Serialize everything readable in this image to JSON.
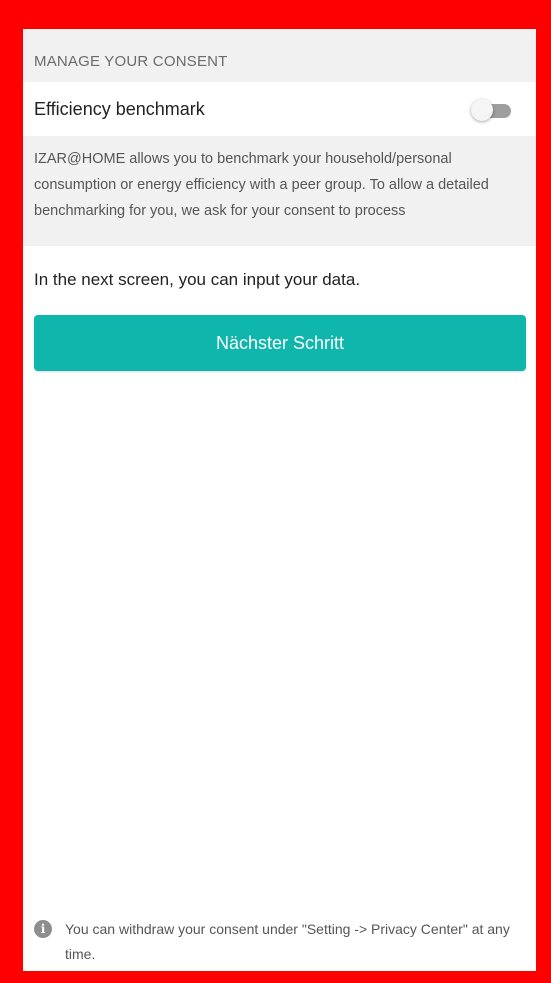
{
  "consent": {
    "section_title": "MANAGE YOUR CONSENT",
    "toggle_label": "Efficiency benchmark",
    "toggle_state": "off",
    "description": "IZAR@HOME allows you to benchmark your household/personal consumption or energy efficiency with a peer group. To allow a detailed benchmarking for you, we ask for your consent to process"
  },
  "main": {
    "next_screen_text": "In the next screen, you can input your data.",
    "next_button_label": "Nächster Schritt"
  },
  "footer": {
    "info_icon": "info-icon",
    "note": "You can withdraw your consent under \"Setting -> Privacy Center\" at any time."
  },
  "colors": {
    "frame_border": "#ff0000",
    "accent": "#0fb6ab",
    "section_bg": "#f1f1f1",
    "switch_track_off": "#9e9e9e"
  }
}
